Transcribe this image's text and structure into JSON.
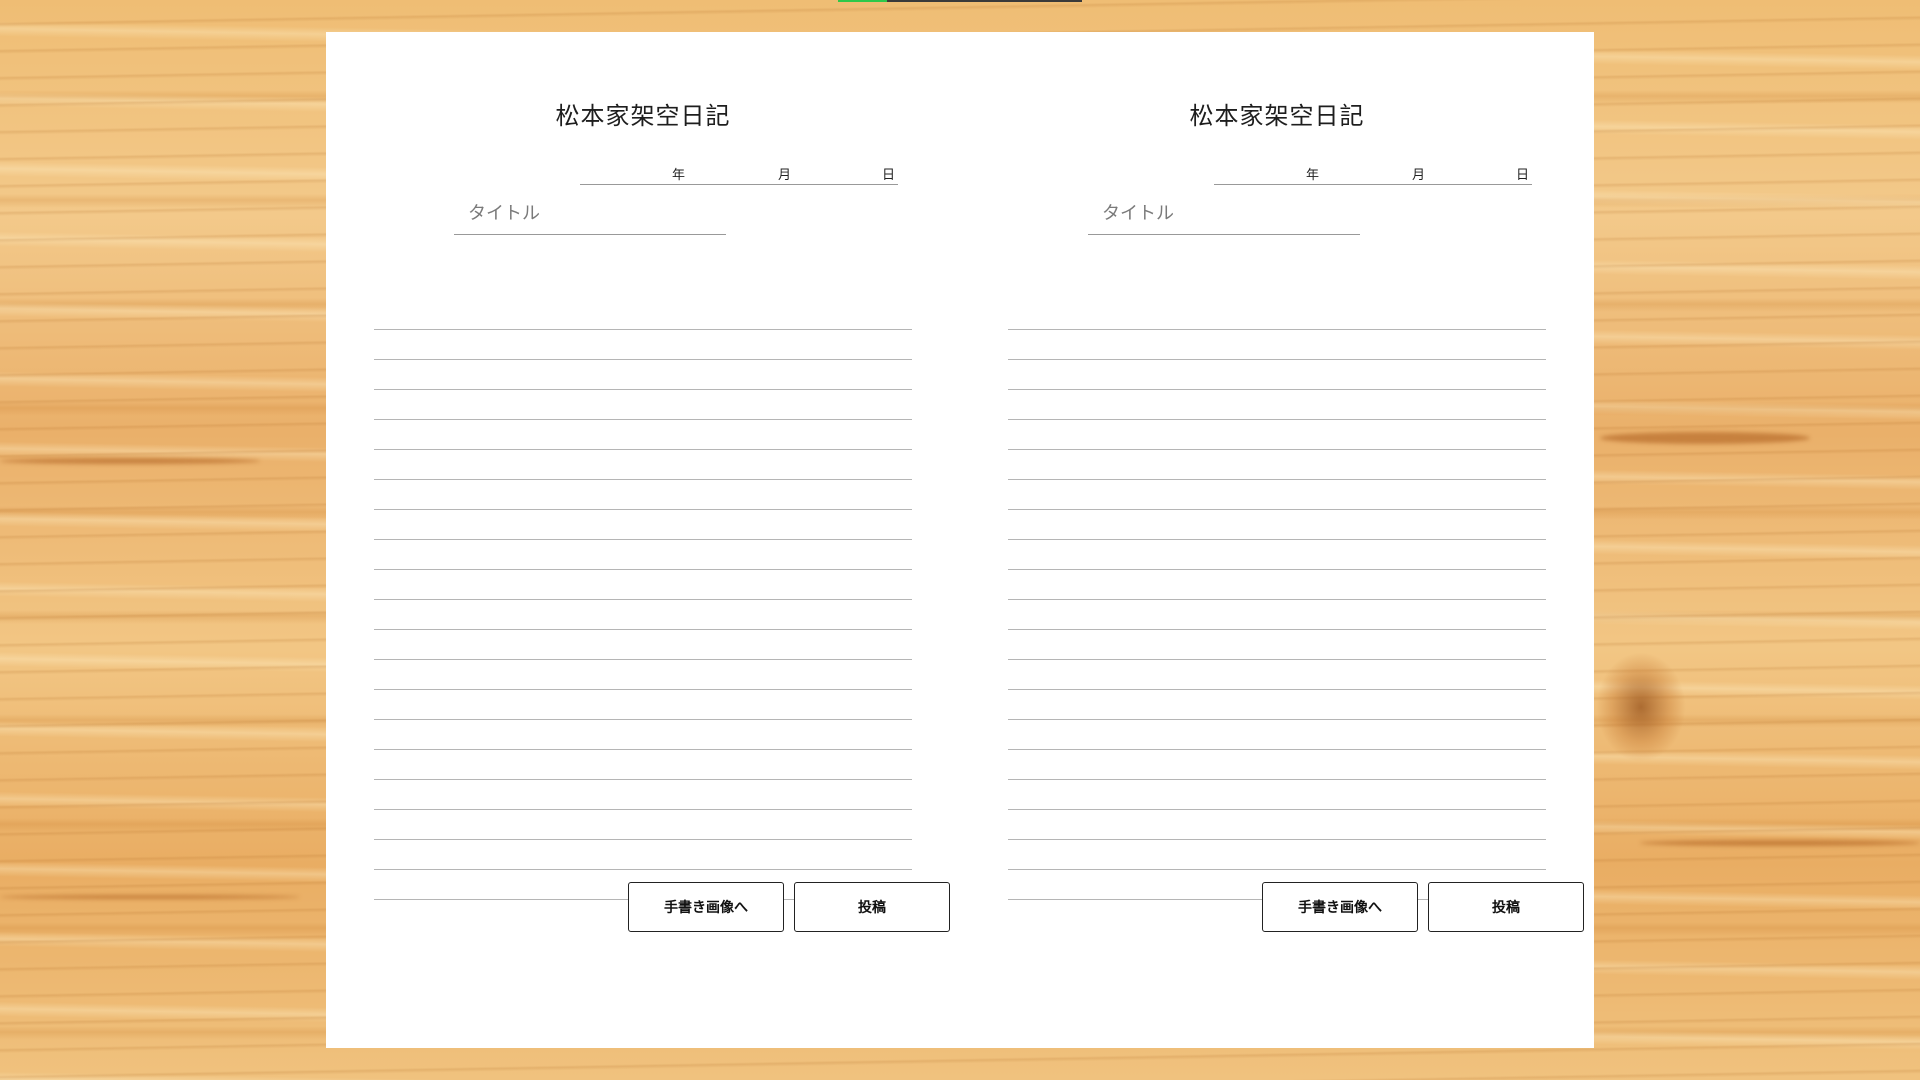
{
  "progress": {
    "fraction": 0.2,
    "fill_color": "#2ec84a"
  },
  "pages": [
    {
      "heading": "松本家架空日記",
      "date": {
        "year_label": "年",
        "month_label": "月",
        "day_label": "日"
      },
      "title_placeholder": "タイトル",
      "body_line_count": 19,
      "buttons": {
        "handwriting_label": "手書き画像へ",
        "post_label": "投稿"
      }
    },
    {
      "heading": "松本家架空日記",
      "date": {
        "year_label": "年",
        "month_label": "月",
        "day_label": "日"
      },
      "title_placeholder": "タイトル",
      "body_line_count": 19,
      "buttons": {
        "handwriting_label": "手書き画像へ",
        "post_label": "投稿"
      }
    }
  ]
}
